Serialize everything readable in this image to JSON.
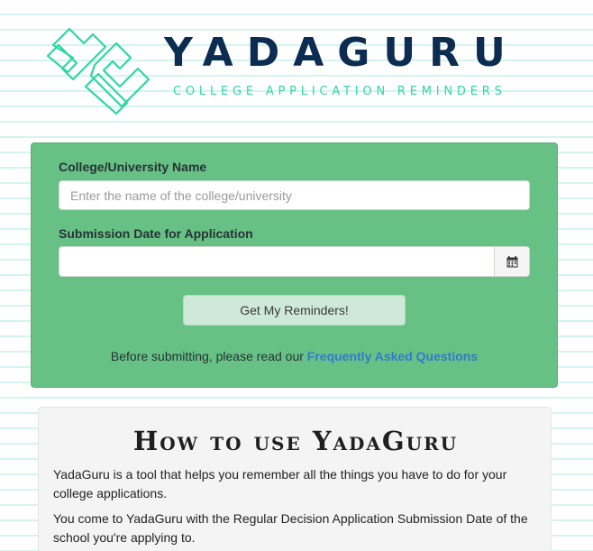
{
  "header": {
    "brand_name": "YADAGURU",
    "tagline": "COLLEGE APPLICATION REMINDERS",
    "logo_icon": "yg-monogram-icon",
    "colors": {
      "brand_navy": "#0d2c52",
      "brand_teal": "#2fd6a6"
    }
  },
  "form": {
    "college_label": "College/University Name",
    "college_placeholder": "Enter the name of the college/university",
    "college_value": "",
    "date_label": "Submission Date for Application",
    "date_value": "",
    "calendar_icon": "calendar-icon",
    "submit_label": "Get My Reminders!",
    "faq_prefix": "Before submitting, please read our ",
    "faq_link_text": "Frequently Asked Questions",
    "colors": {
      "panel_green": "#68c184",
      "link_blue": "#2f7ccf"
    }
  },
  "howto": {
    "title": "How to use YadaGuru",
    "paragraphs": [
      "YadaGuru is a tool that helps you remember all the things you have to do for your college applications.",
      "You come to YadaGuru with the Regular Decision Application Submission Date of the school you're applying to."
    ]
  }
}
